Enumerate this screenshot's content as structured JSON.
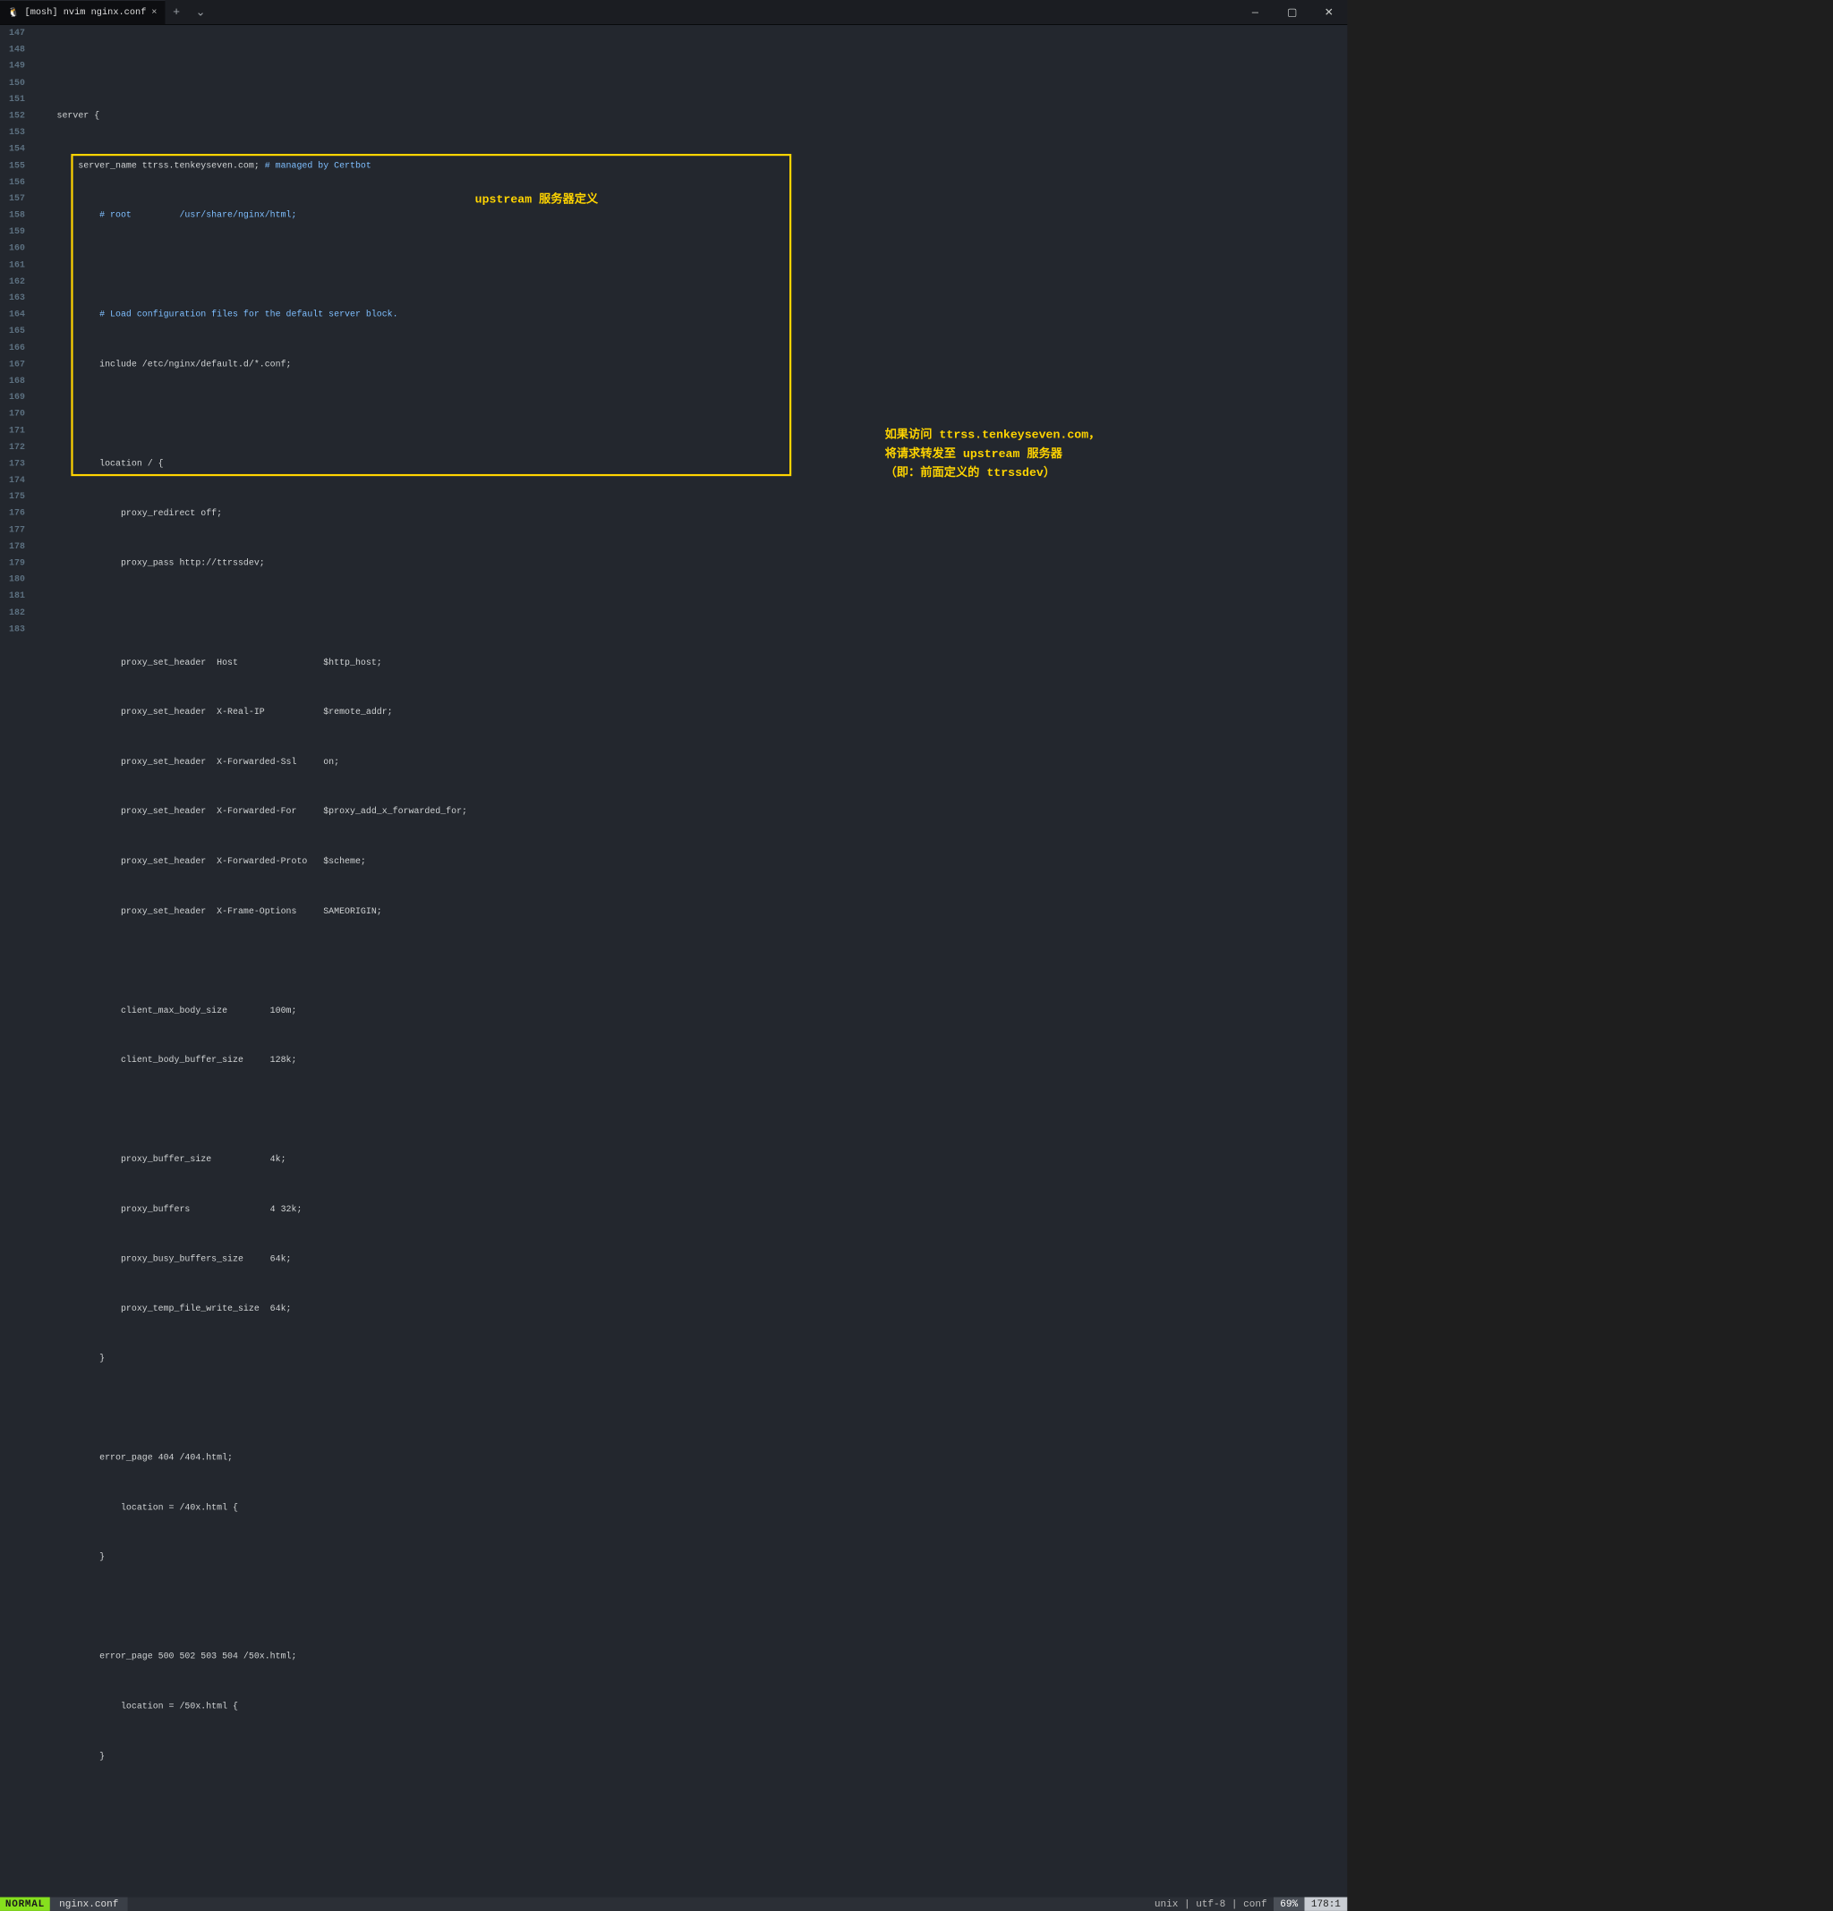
{
  "titlebar": {
    "tab_icon": "🐧",
    "tab_title": "[mosh] nvim nginx.conf",
    "close": "×",
    "add": "+",
    "chev": "⌄",
    "min": "—",
    "max": "▢",
    "x": "✕"
  },
  "gutter": {
    "start": 147,
    "end": 183
  },
  "code": {
    "l147": "",
    "l148": "    server {",
    "l149a": "        server_name ttrss.tenkeyseven.com; ",
    "l149b": "# managed by Certbot",
    "l150": "            # root         /usr/share/nginx/html;",
    "l151": "",
    "l152": "            # Load configuration files for the default server block.",
    "l153": "            include /etc/nginx/default.d/*.conf;",
    "l154": "",
    "l155": "            location / {",
    "l156": "                proxy_redirect off;",
    "l157": "                proxy_pass http://ttrssdev;",
    "l158": "",
    "l159": "                proxy_set_header  Host                $http_host;",
    "l160": "                proxy_set_header  X-Real-IP           $remote_addr;",
    "l161": "                proxy_set_header  X-Forwarded-Ssl     on;",
    "l162": "                proxy_set_header  X-Forwarded-For     $proxy_add_x_forwarded_for;",
    "l163": "                proxy_set_header  X-Forwarded-Proto   $scheme;",
    "l164": "                proxy_set_header  X-Frame-Options     SAMEORIGIN;",
    "l165": "",
    "l166": "                client_max_body_size        100m;",
    "l167": "                client_body_buffer_size     128k;",
    "l168": "",
    "l169": "                proxy_buffer_size           4k;",
    "l170": "                proxy_buffers               4 32k;",
    "l171": "                proxy_busy_buffers_size     64k;",
    "l172": "                proxy_temp_file_write_size  64k;",
    "l173": "            }",
    "l174": "",
    "l175": "            error_page 404 /404.html;",
    "l176": "                location = /40x.html {",
    "l177": "            }",
    "l178": "",
    "l179": "            error_page 500 502 503 504 /50x.html;",
    "l180": "                location = /50x.html {",
    "l181": "            }",
    "l182": "",
    "l183": ""
  },
  "annotations": {
    "a1": "upstream 服务器定义",
    "a2_l1": "如果访问 ttrss.tenkeyseven.com，",
    "a2_l2": "将请求转发至 upstream 服务器",
    "a2_l3": "（即：前面定义的 ttrssdev）"
  },
  "status": {
    "mode": "NORMAL",
    "file": "nginx.conf",
    "enc": "unix  |  utf-8  |  conf",
    "pct": "69%",
    "pos": "178:1"
  }
}
